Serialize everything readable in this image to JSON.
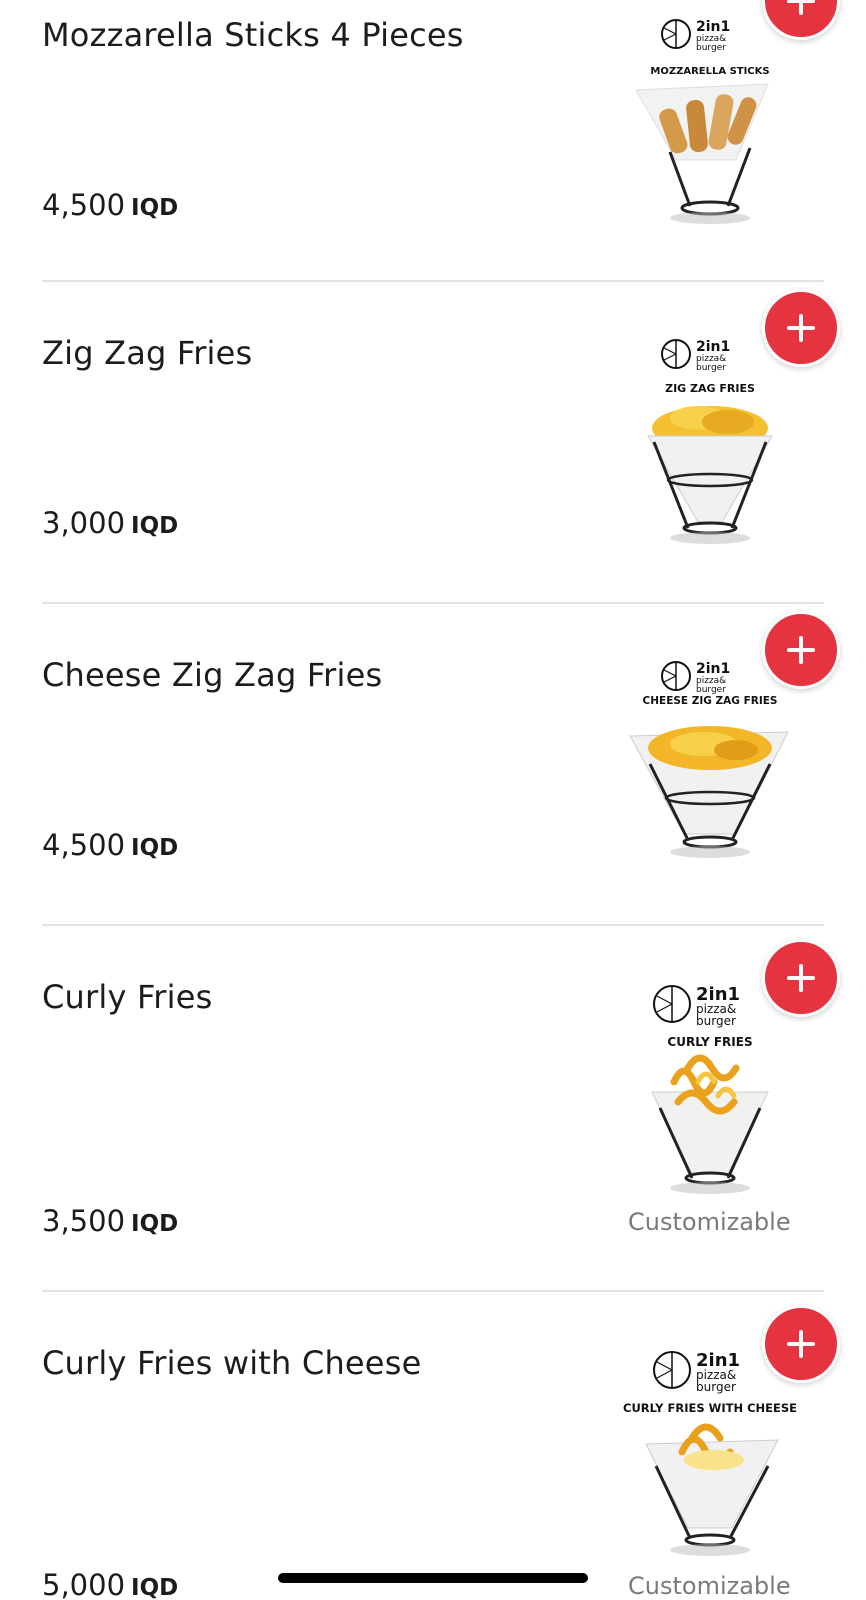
{
  "items": [
    {
      "name": "Mozzarella Sticks  4 Pieces",
      "price": "4,500",
      "currency": "IQD",
      "image_caption": "MOZZARELLA STICKS",
      "customizable": ""
    },
    {
      "name": "Zig Zag Fries",
      "price": "3,000",
      "currency": "IQD",
      "image_caption": "ZIG ZAG FRIES",
      "customizable": ""
    },
    {
      "name": "Cheese Zig Zag Fries",
      "price": "4,500",
      "currency": "IQD",
      "image_caption": "CHEESE ZIG ZAG FRIES",
      "customizable": ""
    },
    {
      "name": "Curly Fries",
      "price": "3,500",
      "currency": "IQD",
      "image_caption": "CURLY FRIES",
      "customizable": "Customizable"
    },
    {
      "name": "Curly Fries with Cheese",
      "price": "5,000",
      "currency": "IQD",
      "image_caption": "CURLY FRIES WITH CHEESE",
      "customizable": "Customizable"
    }
  ],
  "brand": {
    "line1": "2in1",
    "line2": "pizza&",
    "line3": "burger"
  },
  "colors": {
    "accent": "#e63340",
    "divider": "#e3e3e3",
    "muted_text": "#7a7a7a"
  },
  "icons": {
    "add": "plus-icon"
  }
}
